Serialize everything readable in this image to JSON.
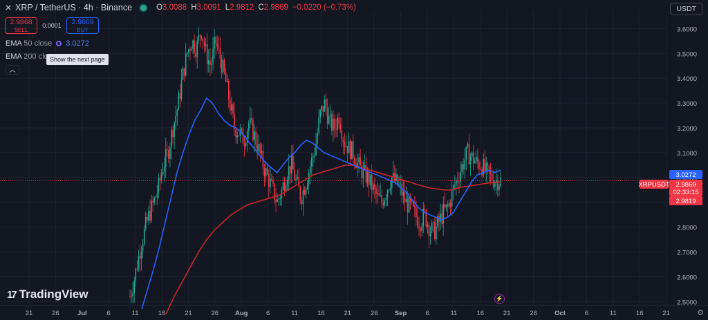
{
  "header": {
    "symbol": "XRP / TetherUS · 4h · Binance",
    "ohlc": [
      {
        "k": "O",
        "v": "3.0088"
      },
      {
        "k": "H",
        "v": "3.0091"
      },
      {
        "k": "L",
        "v": "2.9812"
      },
      {
        "k": "C",
        "v": "2.9869"
      },
      {
        "k": "",
        "v": "−0.0220 (−0.73%)"
      }
    ],
    "currency": "USDT"
  },
  "trade": {
    "sell_price": "2.9868",
    "sell_label": "SELL",
    "spread": "0.0001",
    "buy_price": "2.9869",
    "buy_label": "BUY"
  },
  "indicators": {
    "ema50_name": "EMA",
    "ema50_args": "50 close",
    "ema50_value": "3.0272",
    "ema200_name": "EMA",
    "ema200_args": "200 close",
    "ema200_value": "2.9819"
  },
  "tooltip": "Show the next page",
  "branding": "TradingView",
  "colors": {
    "background": "#131722",
    "up": "#22ab94",
    "down": "#f23645",
    "ema50": "#2962ff",
    "ema200": "#c62828",
    "grid": "#1e222d"
  },
  "chart_data": {
    "type": "candlestick",
    "y_ticks": [
      "3.6000",
      "3.5000",
      "3.4000",
      "3.3000",
      "3.2000",
      "3.1000",
      "3.0000",
      "2.9000",
      "2.8000",
      "2.7000",
      "2.6000",
      "2.5000"
    ],
    "ylim": [
      2.49,
      3.665
    ],
    "x_ticks": [
      "21",
      "26",
      "Jul",
      "6",
      "11",
      "16",
      "21",
      "26",
      "Aug",
      "6",
      "11",
      "16",
      "21",
      "26",
      "Sep",
      "6",
      "11",
      "16",
      "21",
      "26",
      "Oct",
      "6",
      "11",
      "16",
      "21"
    ],
    "close_series": [
      2.52,
      2.6,
      2.7,
      2.78,
      2.85,
      2.9,
      2.96,
      3.05,
      3.1,
      3.2,
      3.28,
      3.4,
      3.5,
      3.55,
      3.52,
      3.6,
      3.5,
      3.45,
      3.55,
      3.48,
      3.4,
      3.3,
      3.2,
      3.18,
      3.15,
      3.22,
      3.18,
      3.12,
      3.05,
      3.0,
      2.95,
      2.9,
      2.95,
      3.02,
      3.05,
      2.98,
      2.92,
      2.98,
      3.05,
      3.12,
      3.25,
      3.3,
      3.22,
      3.2,
      3.25,
      3.15,
      3.12,
      3.1,
      3.05,
      3.02,
      3.0,
      2.96,
      2.92,
      2.9,
      2.95,
      3.0,
      2.98,
      2.95,
      2.9,
      2.88,
      2.85,
      2.82,
      2.85,
      2.8,
      2.78,
      2.82,
      2.86,
      2.88,
      2.95,
      3.0,
      3.05,
      3.1,
      3.08,
      3.06,
      3.05,
      3.02,
      3.0,
      2.99,
      2.987
    ],
    "ema50_series": [
      2.47,
      2.55,
      2.63,
      2.72,
      2.82,
      2.92,
      3.02,
      3.1,
      3.17,
      3.23,
      3.27,
      3.32,
      3.3,
      3.26,
      3.23,
      3.21,
      3.2,
      3.18,
      3.15,
      3.12,
      3.09,
      3.06,
      3.04,
      3.02,
      3.05,
      3.08,
      3.1,
      3.13,
      3.15,
      3.14,
      3.12,
      3.1,
      3.09,
      3.08,
      3.07,
      3.06,
      3.05,
      3.04,
      3.03,
      3.02,
      3.01,
      3.0,
      2.99,
      2.98,
      2.96,
      2.94,
      2.91,
      2.88,
      2.86,
      2.85,
      2.84,
      2.83,
      2.84,
      2.86,
      2.9,
      2.94,
      2.98,
      3.01,
      3.02,
      3.03,
      3.02,
      3.03
    ],
    "ema200_series": [
      2.45,
      2.52,
      2.58,
      2.64,
      2.7,
      2.75,
      2.79,
      2.82,
      2.85,
      2.87,
      2.89,
      2.9,
      2.91,
      2.92,
      2.93,
      2.95,
      2.97,
      2.99,
      3.01,
      3.02,
      3.03,
      3.04,
      3.05,
      3.05,
      3.04,
      3.03,
      3.02,
      3.01,
      3.0,
      2.99,
      2.98,
      2.97,
      2.96,
      2.955,
      2.95,
      2.95,
      2.96,
      2.965,
      2.97,
      2.975,
      2.98,
      2.982
    ],
    "price_labels": [
      {
        "label": "3.0272",
        "kind": "ema50"
      },
      {
        "label": "XRPUSDT",
        "kind": "symbol"
      },
      {
        "label": "2.9869",
        "kind": "last"
      },
      {
        "label": "02:33:15",
        "kind": "countdown"
      },
      {
        "label": "2.9819",
        "kind": "ema200"
      }
    ]
  }
}
